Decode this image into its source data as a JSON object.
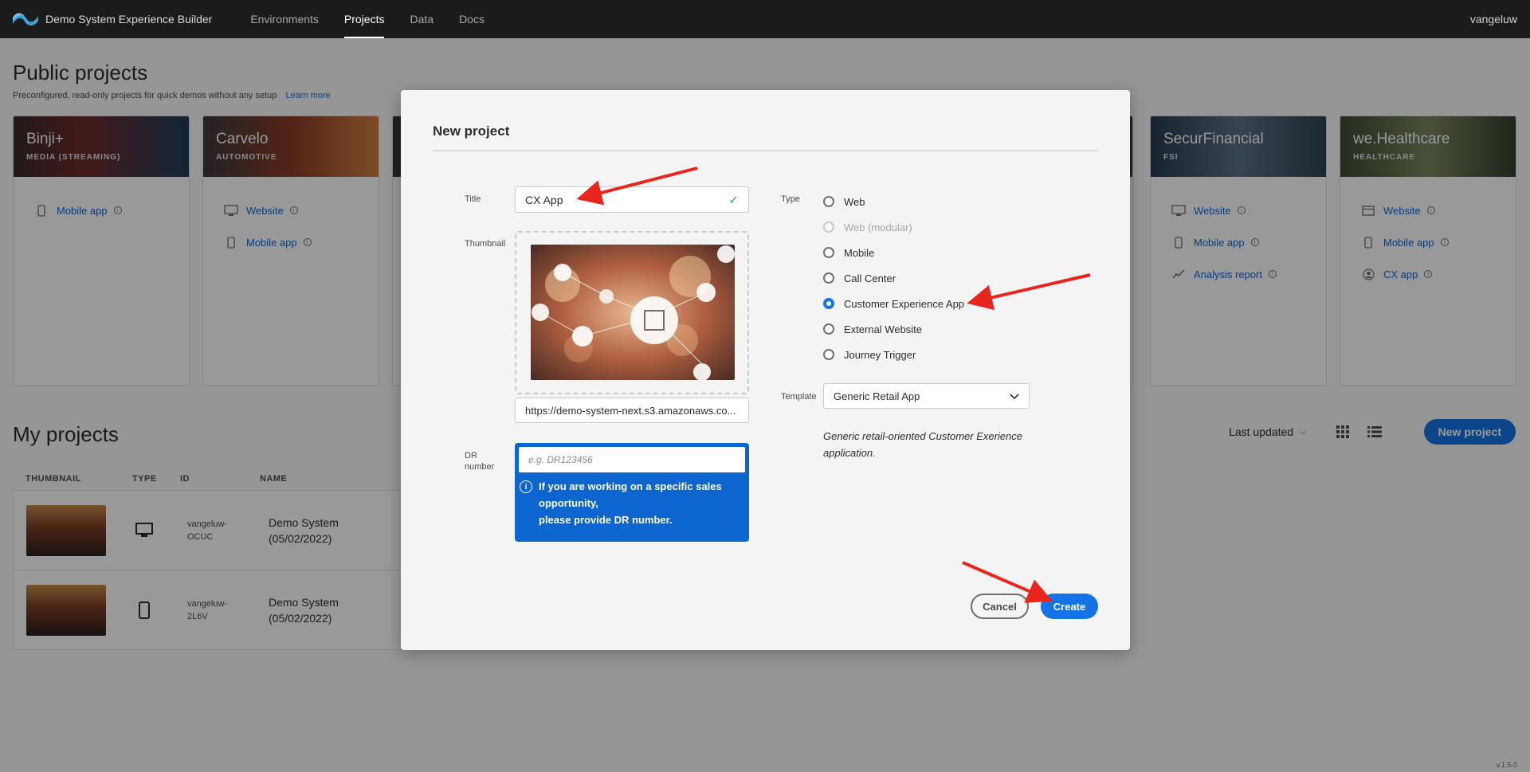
{
  "app": {
    "name": "Demo System Experience Builder",
    "user": "vangeluw",
    "version": "v.1.5.0"
  },
  "nav": [
    {
      "label": "Environments",
      "active": false
    },
    {
      "label": "Projects",
      "active": true
    },
    {
      "label": "Data",
      "active": false
    },
    {
      "label": "Docs",
      "active": false
    }
  ],
  "public_projects": {
    "title": "Public projects",
    "subtitle": "Preconfigured, read-only projects for quick demos without any setup",
    "learn_more": "Learn more",
    "cards": [
      {
        "name": "Binji+",
        "category": "MEDIA (STREAMING)",
        "links": [
          {
            "label": "Mobile app",
            "icon": "phone-icon"
          }
        ]
      },
      {
        "name": "Carvelo",
        "category": "AUTOMOTIVE",
        "links": [
          {
            "label": "Website",
            "icon": "monitor-icon"
          },
          {
            "label": "Mobile app",
            "icon": "phone-icon"
          }
        ]
      },
      {
        "name": "SecurFinancial",
        "category": "FSI",
        "links": [
          {
            "label": "Website",
            "icon": "monitor-icon"
          },
          {
            "label": "Mobile app",
            "icon": "phone-icon"
          },
          {
            "label": "Analysis report",
            "icon": "chart-icon"
          }
        ]
      },
      {
        "name": "we.Healthcare",
        "category": "HEALTHCARE",
        "links": [
          {
            "label": "Website",
            "icon": "browser-icon"
          },
          {
            "label": "Mobile app",
            "icon": "phone-icon"
          },
          {
            "label": "CX app",
            "icon": "user-icon"
          }
        ]
      }
    ]
  },
  "my_projects": {
    "title": "My projects",
    "sort_label": "Last updated",
    "new_project_label": "New project",
    "columns": [
      "THUMBNAIL",
      "TYPE",
      "ID",
      "NAME"
    ],
    "rows": [
      {
        "type_icon": "monitor-icon",
        "id_line1": "vangeluw-",
        "id_line2": "OCUC",
        "name_line1": "Demo System",
        "name_line2": "(05/02/2022)"
      },
      {
        "type_icon": "phone-icon",
        "id_line1": "vangeluw-",
        "id_line2": "2L6V",
        "name_line1": "Demo System",
        "name_line2": "(05/02/2022)"
      }
    ]
  },
  "modal": {
    "title": "New project",
    "title_label": "Title",
    "title_value": "CX App",
    "thumbnail_label": "Thumbnail",
    "thumbnail_url": "https://demo-system-next.s3.amazonaws.co...",
    "dr_label_1": "DR",
    "dr_label_2": "number",
    "dr_placeholder": "e.g. DR123456",
    "dr_info_1": "If you are working on a specific sales",
    "dr_info_2": "opportunity,",
    "dr_info_3": "please provide DR number.",
    "type_label": "Type",
    "types": [
      {
        "label": "Web",
        "state": "default"
      },
      {
        "label": "Web (modular)",
        "state": "disabled"
      },
      {
        "label": "Mobile",
        "state": "default"
      },
      {
        "label": "Call Center",
        "state": "default"
      },
      {
        "label": "Customer Experience App",
        "state": "selected"
      },
      {
        "label": "External Website",
        "state": "default"
      },
      {
        "label": "Journey Trigger",
        "state": "default"
      }
    ],
    "template_label": "Template",
    "template_value": "Generic Retail App",
    "template_desc_1": "Generic retail-oriented Customer Exerience",
    "template_desc_2": "application.",
    "cancel_label": "Cancel",
    "create_label": "Create"
  },
  "colors": {
    "accent": "#1473e6",
    "topbar": "#1b1b1b",
    "annotation_arrow": "#e8261e",
    "success": "#2d9d78"
  }
}
